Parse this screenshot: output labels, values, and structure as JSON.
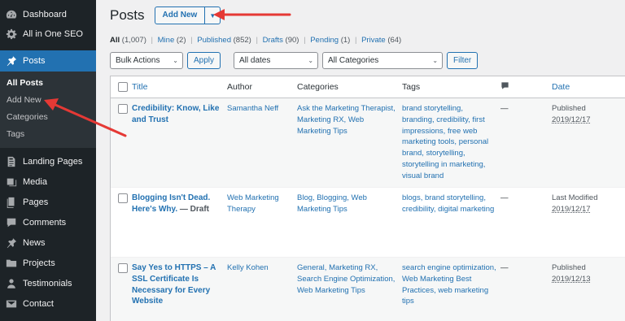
{
  "sidebar": {
    "items": [
      {
        "label": "Dashboard",
        "icon": "dashboard-icon"
      },
      {
        "label": "All in One SEO",
        "icon": "gear-icon"
      },
      {
        "label": "Posts",
        "icon": "pin-icon"
      },
      {
        "label": "Landing Pages",
        "icon": "page-icon"
      },
      {
        "label": "Media",
        "icon": "media-icon"
      },
      {
        "label": "Pages",
        "icon": "page-icon"
      },
      {
        "label": "Comments",
        "icon": "comment-icon"
      },
      {
        "label": "News",
        "icon": "pin-icon"
      },
      {
        "label": "Projects",
        "icon": "folder-icon"
      },
      {
        "label": "Testimonials",
        "icon": "person-icon"
      },
      {
        "label": "Contact",
        "icon": "mail-icon"
      }
    ],
    "submenu": [
      "All Posts",
      "Add New",
      "Categories",
      "Tags"
    ]
  },
  "header": {
    "title": "Posts",
    "add_new": "Add New"
  },
  "views": {
    "all": "All",
    "all_count": "(1,007)",
    "mine": "Mine",
    "mine_count": "(2)",
    "published": "Published",
    "published_count": "(852)",
    "drafts": "Drafts",
    "drafts_count": "(90)",
    "pending": "Pending",
    "pending_count": "(1)",
    "private": "Private",
    "private_count": "(64)",
    "separator": "|"
  },
  "filters": {
    "bulk_actions": "Bulk Actions",
    "apply": "Apply",
    "dates": "All dates",
    "categories": "All Categories",
    "filter": "Filter"
  },
  "table": {
    "headers": {
      "title": "Title",
      "author": "Author",
      "categories": "Categories",
      "tags": "Tags",
      "date": "Date"
    },
    "rows": [
      {
        "title": "Credibility: Know, Like and Trust",
        "draft": "",
        "author": "Samantha Neff",
        "categories": "Ask the Marketing Therapist, Marketing RX, Web Marketing Tips",
        "tags": "brand storytelling, branding, credibility, first impressions, free web marketing tools, personal brand, storytelling, storytelling in marketing, visual brand",
        "comments": "—",
        "status": "Published",
        "date": "2019/12/17"
      },
      {
        "title": "Blogging Isn't Dead. Here's Why.",
        "draft": " — Draft",
        "author": "Web Marketing Therapy",
        "categories": "Blog, Blogging, Web Marketing Tips",
        "tags": "blogs, brand storytelling, credibility, digital marketing",
        "comments": "—",
        "status": "Last Modified",
        "date": "2019/12/17"
      },
      {
        "title": "Say Yes to HTTPS – A SSL Certificate Is Necessary for Every Website",
        "draft": "",
        "author": "Kelly Kohen",
        "categories": "General, Marketing RX, Search Engine Optimization, Web Marketing Tips",
        "tags": "search engine optimization, Web Marketing Best Practices, web marketing tips",
        "comments": "—",
        "status": "Published",
        "date": "2019/12/13"
      }
    ]
  },
  "colors": {
    "accent": "#2271b1",
    "sidebar": "#1d2327",
    "arrow": "#e53935"
  }
}
